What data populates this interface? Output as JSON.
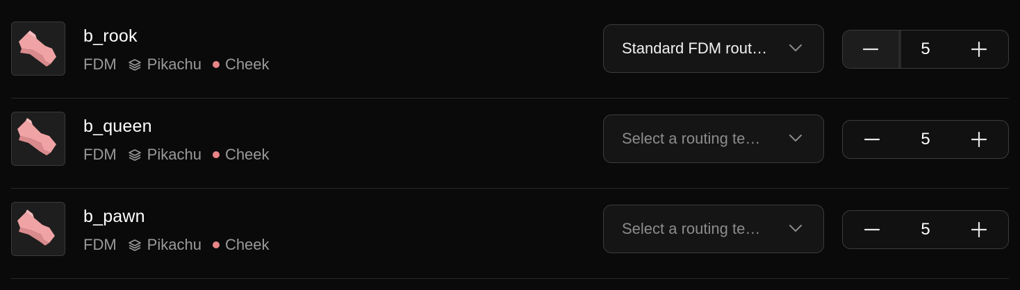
{
  "colors": {
    "background": "#0a0a0a",
    "accent_dot": "#e88587",
    "part_color": "#f0a3a5"
  },
  "items": [
    {
      "name": "b_rook",
      "process": "FDM",
      "layer_icon": "layers-icon",
      "material": "Pikachu",
      "color_label": "Cheek",
      "routing": "Standard FDM rout…",
      "routing_selected": true,
      "quantity": "5"
    },
    {
      "name": "b_queen",
      "process": "FDM",
      "layer_icon": "layers-icon",
      "material": "Pikachu",
      "color_label": "Cheek",
      "routing": "Select a routing te…",
      "routing_selected": false,
      "quantity": "5"
    },
    {
      "name": "b_pawn",
      "process": "FDM",
      "layer_icon": "layers-icon",
      "material": "Pikachu",
      "color_label": "Cheek",
      "routing": "Select a routing te…",
      "routing_selected": false,
      "quantity": "5"
    }
  ]
}
